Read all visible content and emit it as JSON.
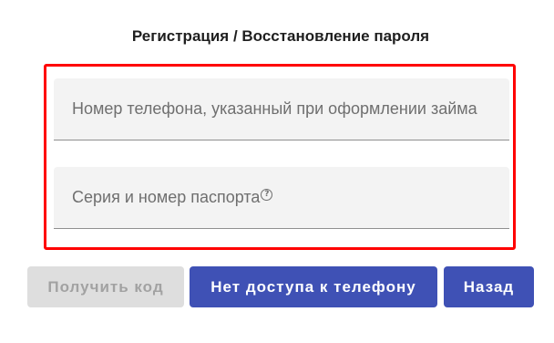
{
  "title": "Регистрация / Восстановление пароля",
  "form": {
    "phone_field": {
      "label": "Номер телефона, указанный при оформлении займа",
      "value": ""
    },
    "passport_field": {
      "label": "Серия и номер паспорта",
      "value": "",
      "help_icon": "question-circle-icon",
      "help_glyph": "?"
    },
    "highlight_color": "#ff0000"
  },
  "buttons": {
    "get_code": {
      "label": "Получить код",
      "disabled": true
    },
    "no_phone_access": {
      "label": "Нет доступа к телефону"
    },
    "back": {
      "label": "Назад"
    }
  },
  "colors": {
    "primary": "#3f51b5",
    "disabled_bg": "#dedede",
    "disabled_text": "#a2a2a2",
    "field_bg": "#f3f3f3"
  }
}
